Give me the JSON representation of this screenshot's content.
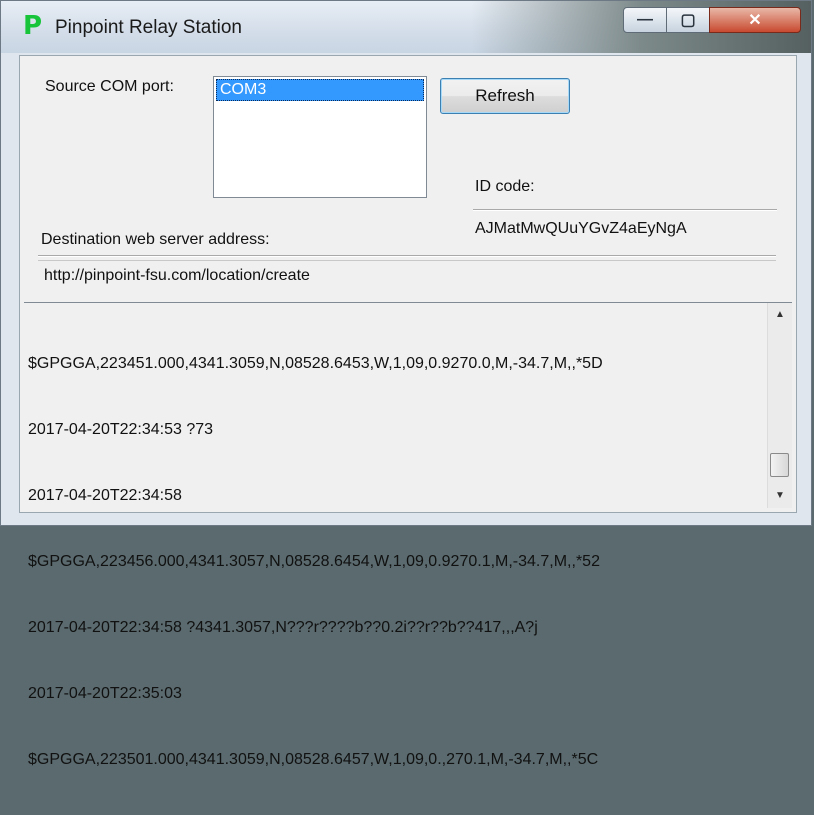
{
  "window": {
    "title": "Pinpoint Relay Station",
    "icon_glyph": "P",
    "controls": {
      "minimize": "—",
      "maximize": "▢",
      "close": "✕"
    }
  },
  "source": {
    "label": "Source COM port:",
    "ports": [
      "COM3"
    ],
    "selected": "COM3"
  },
  "refresh_button": "Refresh",
  "id": {
    "label": "ID code:",
    "value": "AJMatMwQUuYGvZ4aEyNgA"
  },
  "destination": {
    "label": "Destination web server address:",
    "value": "http://pinpoint-fsu.com/location/create"
  },
  "log": {
    "lines": [
      "$GPGGA,223451.000,4341.3059,N,08528.6453,W,1,09,0.9270.0,M,-34.7,M,,*5D",
      "2017-04-20T22:34:53 ?73",
      "2017-04-20T22:34:58",
      "$GPGGA,223456.000,4341.3057,N,08528.6454,W,1,09,0.9270.1,M,-34.7,M,,*52",
      "2017-04-20T22:34:58 ?4341.3057,N???r????b??0.2i??r??b??417,,,A?j",
      "2017-04-20T22:35:03",
      "$GPGGA,223501.000,4341.3059,N,08528.6457,W,1,09,0.,270.1,M,-34.7,M,,*5C"
    ]
  },
  "colors": {
    "selection": "#3399ff",
    "icon": "#17c43a",
    "close": "#c84a30"
  }
}
